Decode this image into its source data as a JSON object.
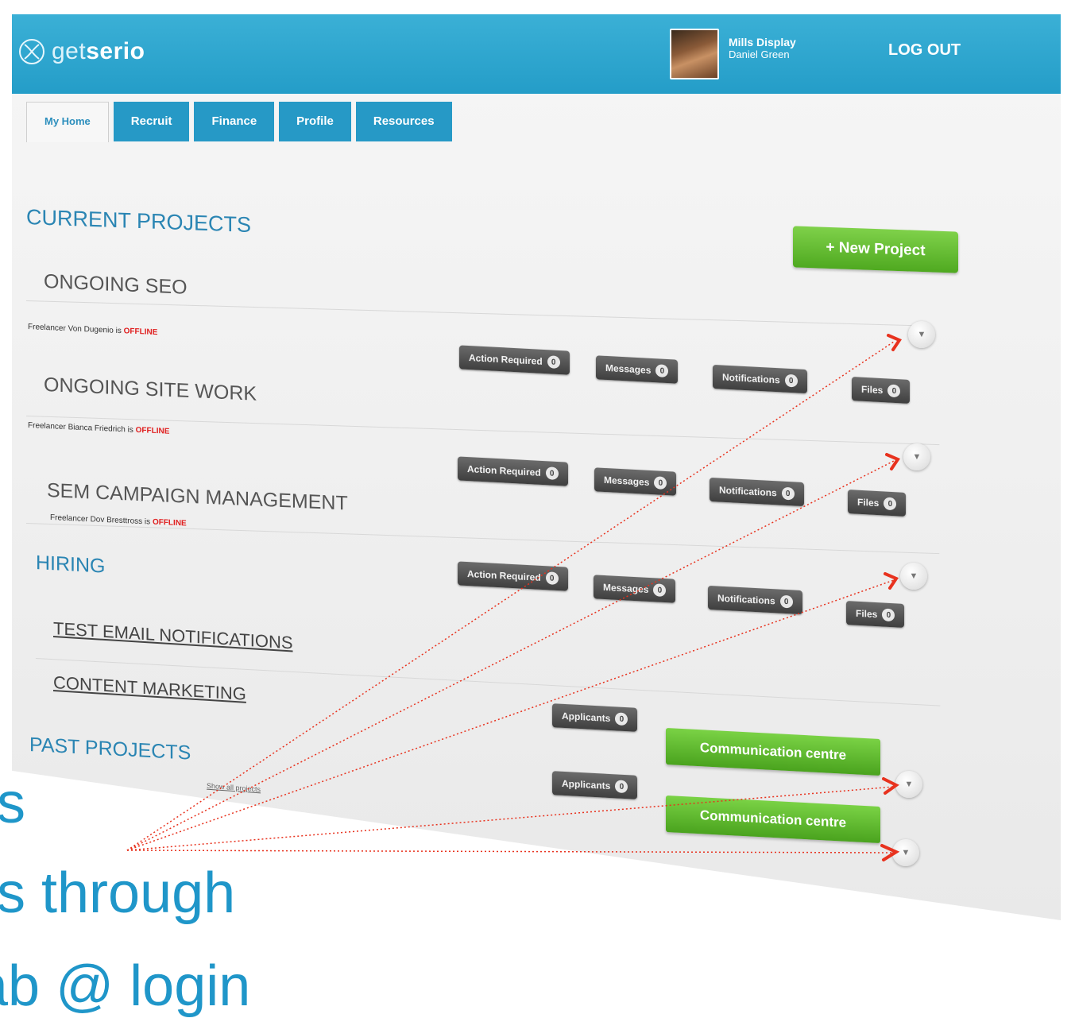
{
  "app": {
    "logo_prefix": "get",
    "logo_bold": "serio",
    "company": "Mills Display",
    "user_name": "Daniel Green",
    "logout": "LOG OUT"
  },
  "tabs": [
    "My Home",
    "Recruit",
    "Finance",
    "Profile",
    "Resources"
  ],
  "current_projects_heading": "CURRENT PROJECTS",
  "new_project_label": "+ New Project",
  "projects": [
    {
      "title": "ONGOING SEO",
      "freelancer": "Freelancer Von Dugenio is",
      "status": "OFFLINE"
    },
    {
      "title": "ONGOING SITE WORK",
      "freelancer": "Freelancer Bianca Friedrich is",
      "status": "OFFLINE"
    },
    {
      "title": "SEM CAMPAIGN MANAGEMENT",
      "freelancer": "Freelancer Dov Bresttross is",
      "status": "OFFLINE"
    }
  ],
  "project_buttons": {
    "action": "Action Required",
    "messages": "Messages",
    "notifications": "Notifications",
    "files": "Files",
    "counts": [
      "0",
      "0",
      "0",
      "0"
    ]
  },
  "hiring_heading": "HIRING",
  "hiring": [
    {
      "title": "TEST EMAIL NOTIFICATIONS",
      "applicants": "Applicants",
      "count": "0",
      "comm": "Communication centre"
    },
    {
      "title": "CONTENT MARKETING",
      "applicants": "Applicants",
      "count": "0",
      "comm": "Communication centre"
    }
  ],
  "past_projects_heading": "PAST PROJECTS",
  "past_projects_note": "Show all projects",
  "slide_lines": [
    "s",
    "s through",
    "ab @ login"
  ],
  "colors": {
    "accent": "#249dc8",
    "green": "#5cb82c",
    "offline": "#e02020",
    "annotation": "#e8321e"
  }
}
